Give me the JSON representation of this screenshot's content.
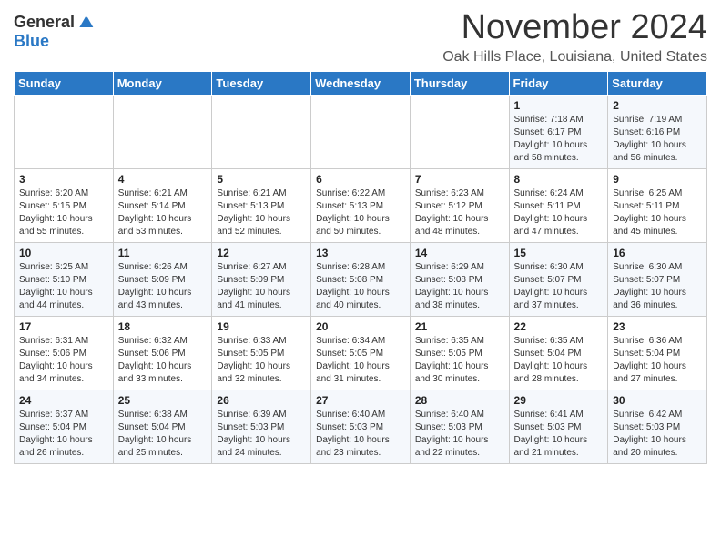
{
  "header": {
    "logo_general": "General",
    "logo_blue": "Blue",
    "month": "November 2024",
    "location": "Oak Hills Place, Louisiana, United States"
  },
  "weekdays": [
    "Sunday",
    "Monday",
    "Tuesday",
    "Wednesday",
    "Thursday",
    "Friday",
    "Saturday"
  ],
  "weeks": [
    [
      {
        "day": "",
        "info": ""
      },
      {
        "day": "",
        "info": ""
      },
      {
        "day": "",
        "info": ""
      },
      {
        "day": "",
        "info": ""
      },
      {
        "day": "",
        "info": ""
      },
      {
        "day": "1",
        "info": "Sunrise: 7:18 AM\nSunset: 6:17 PM\nDaylight: 10 hours\nand 58 minutes."
      },
      {
        "day": "2",
        "info": "Sunrise: 7:19 AM\nSunset: 6:16 PM\nDaylight: 10 hours\nand 56 minutes."
      }
    ],
    [
      {
        "day": "3",
        "info": "Sunrise: 6:20 AM\nSunset: 5:15 PM\nDaylight: 10 hours\nand 55 minutes."
      },
      {
        "day": "4",
        "info": "Sunrise: 6:21 AM\nSunset: 5:14 PM\nDaylight: 10 hours\nand 53 minutes."
      },
      {
        "day": "5",
        "info": "Sunrise: 6:21 AM\nSunset: 5:13 PM\nDaylight: 10 hours\nand 52 minutes."
      },
      {
        "day": "6",
        "info": "Sunrise: 6:22 AM\nSunset: 5:13 PM\nDaylight: 10 hours\nand 50 minutes."
      },
      {
        "day": "7",
        "info": "Sunrise: 6:23 AM\nSunset: 5:12 PM\nDaylight: 10 hours\nand 48 minutes."
      },
      {
        "day": "8",
        "info": "Sunrise: 6:24 AM\nSunset: 5:11 PM\nDaylight: 10 hours\nand 47 minutes."
      },
      {
        "day": "9",
        "info": "Sunrise: 6:25 AM\nSunset: 5:11 PM\nDaylight: 10 hours\nand 45 minutes."
      }
    ],
    [
      {
        "day": "10",
        "info": "Sunrise: 6:25 AM\nSunset: 5:10 PM\nDaylight: 10 hours\nand 44 minutes."
      },
      {
        "day": "11",
        "info": "Sunrise: 6:26 AM\nSunset: 5:09 PM\nDaylight: 10 hours\nand 43 minutes."
      },
      {
        "day": "12",
        "info": "Sunrise: 6:27 AM\nSunset: 5:09 PM\nDaylight: 10 hours\nand 41 minutes."
      },
      {
        "day": "13",
        "info": "Sunrise: 6:28 AM\nSunset: 5:08 PM\nDaylight: 10 hours\nand 40 minutes."
      },
      {
        "day": "14",
        "info": "Sunrise: 6:29 AM\nSunset: 5:08 PM\nDaylight: 10 hours\nand 38 minutes."
      },
      {
        "day": "15",
        "info": "Sunrise: 6:30 AM\nSunset: 5:07 PM\nDaylight: 10 hours\nand 37 minutes."
      },
      {
        "day": "16",
        "info": "Sunrise: 6:30 AM\nSunset: 5:07 PM\nDaylight: 10 hours\nand 36 minutes."
      }
    ],
    [
      {
        "day": "17",
        "info": "Sunrise: 6:31 AM\nSunset: 5:06 PM\nDaylight: 10 hours\nand 34 minutes."
      },
      {
        "day": "18",
        "info": "Sunrise: 6:32 AM\nSunset: 5:06 PM\nDaylight: 10 hours\nand 33 minutes."
      },
      {
        "day": "19",
        "info": "Sunrise: 6:33 AM\nSunset: 5:05 PM\nDaylight: 10 hours\nand 32 minutes."
      },
      {
        "day": "20",
        "info": "Sunrise: 6:34 AM\nSunset: 5:05 PM\nDaylight: 10 hours\nand 31 minutes."
      },
      {
        "day": "21",
        "info": "Sunrise: 6:35 AM\nSunset: 5:05 PM\nDaylight: 10 hours\nand 30 minutes."
      },
      {
        "day": "22",
        "info": "Sunrise: 6:35 AM\nSunset: 5:04 PM\nDaylight: 10 hours\nand 28 minutes."
      },
      {
        "day": "23",
        "info": "Sunrise: 6:36 AM\nSunset: 5:04 PM\nDaylight: 10 hours\nand 27 minutes."
      }
    ],
    [
      {
        "day": "24",
        "info": "Sunrise: 6:37 AM\nSunset: 5:04 PM\nDaylight: 10 hours\nand 26 minutes."
      },
      {
        "day": "25",
        "info": "Sunrise: 6:38 AM\nSunset: 5:04 PM\nDaylight: 10 hours\nand 25 minutes."
      },
      {
        "day": "26",
        "info": "Sunrise: 6:39 AM\nSunset: 5:03 PM\nDaylight: 10 hours\nand 24 minutes."
      },
      {
        "day": "27",
        "info": "Sunrise: 6:40 AM\nSunset: 5:03 PM\nDaylight: 10 hours\nand 23 minutes."
      },
      {
        "day": "28",
        "info": "Sunrise: 6:40 AM\nSunset: 5:03 PM\nDaylight: 10 hours\nand 22 minutes."
      },
      {
        "day": "29",
        "info": "Sunrise: 6:41 AM\nSunset: 5:03 PM\nDaylight: 10 hours\nand 21 minutes."
      },
      {
        "day": "30",
        "info": "Sunrise: 6:42 AM\nSunset: 5:03 PM\nDaylight: 10 hours\nand 20 minutes."
      }
    ]
  ]
}
